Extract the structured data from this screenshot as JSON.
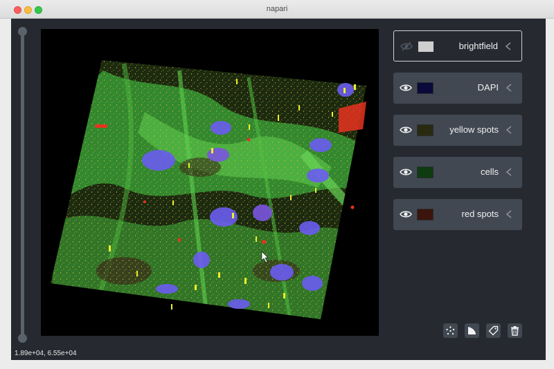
{
  "window": {
    "title": "napari"
  },
  "status": {
    "coordinates": "1.89e+04,  6.55e+04"
  },
  "layers": [
    {
      "name": "brightfield",
      "visible": false,
      "selected": true,
      "thumb_color": "#cfcfcf"
    },
    {
      "name": "DAPI",
      "visible": true,
      "selected": false,
      "thumb_color": "#0a0a3a"
    },
    {
      "name": "yellow spots",
      "visible": true,
      "selected": false,
      "thumb_color": "#2a2a10"
    },
    {
      "name": "cells",
      "visible": true,
      "selected": false,
      "thumb_color": "#0e3b10"
    },
    {
      "name": "red spots",
      "visible": true,
      "selected": false,
      "thumb_color": "#3b140c"
    }
  ],
  "layer_buttons": [
    "new-points",
    "new-shapes",
    "new-labels",
    "delete-layer"
  ],
  "colors": {
    "background": "#262930",
    "panel": "#414851",
    "text": "#f0f1f2",
    "slider": "#5a626c"
  }
}
